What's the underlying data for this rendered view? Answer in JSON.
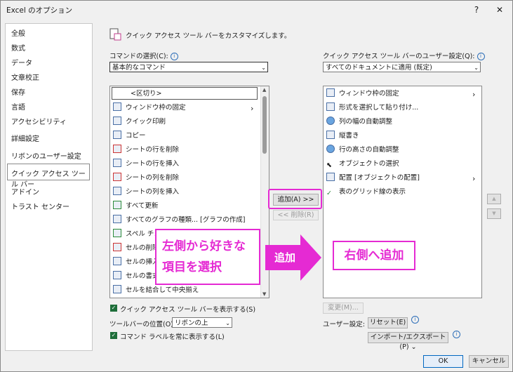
{
  "window": {
    "title": "Excel のオプション",
    "help": "?",
    "close": "✕"
  },
  "sidebar": {
    "items": [
      {
        "label": "全般"
      },
      {
        "label": "数式"
      },
      {
        "label": "データ"
      },
      {
        "label": "文章校正"
      },
      {
        "label": "保存"
      },
      {
        "label": "言語"
      },
      {
        "label": "アクセシビリティ"
      },
      {
        "label": "詳細設定"
      },
      {
        "label": "リボンのユーザー設定"
      },
      {
        "label": "クイック アクセス ツール バー"
      },
      {
        "label": "アドイン"
      },
      {
        "label": "トラスト センター"
      }
    ],
    "selected": "クイック アクセス ツール バー"
  },
  "header": {
    "text": "クイック アクセス ツール バーをカスタマイズします。"
  },
  "left": {
    "choose_label": "コマンドの選択(C):",
    "choose_value": "基本的なコマンド",
    "commands": [
      {
        "label": "<区切り>",
        "icon": "separator"
      },
      {
        "label": "ウィンドウ枠の固定",
        "icon": "freeze-panes-icon",
        "submenu": "›"
      },
      {
        "label": "クイック印刷",
        "icon": "quick-print-icon"
      },
      {
        "label": "コピー",
        "icon": "copy-icon"
      },
      {
        "label": "シートの行を削除",
        "icon": "delete-row-icon"
      },
      {
        "label": "シートの行を挿入",
        "icon": "insert-row-icon"
      },
      {
        "label": "シートの列を削除",
        "icon": "delete-column-icon"
      },
      {
        "label": "シートの列を挿入",
        "icon": "insert-column-icon"
      },
      {
        "label": "すべて更新",
        "icon": "refresh-all-icon"
      },
      {
        "label": "すべてのグラフの種類... [グラフの作成]",
        "icon": "chart-icon"
      },
      {
        "label": "スペル チェ",
        "icon": "spell-check-icon"
      },
      {
        "label": "セルの削除",
        "icon": "delete-cells-icon"
      },
      {
        "label": "セルの挿入",
        "icon": "insert-cells-icon"
      },
      {
        "label": "セルの書式",
        "icon": "format-cells-icon"
      },
      {
        "label": "セルを結合して中央揃え",
        "icon": "merge-center-icon"
      }
    ],
    "show_qat": "クイック アクセス ツール バーを表示する(S)",
    "position_label": "ツールバーの位置(O)",
    "position_value": "リボンの上",
    "always_labels": "コマンド ラベルを常に表示する(L)"
  },
  "middle": {
    "add": "追加(A) >>",
    "remove": "<< 削除(R)"
  },
  "right": {
    "customize_label": "クイック アクセス ツール バーのユーザー設定(Q):",
    "customize_value": "すべてのドキュメントに適用 (既定)",
    "items": [
      {
        "label": "ウィンドウ枠の固定",
        "submenu": "›"
      },
      {
        "label": "形式を選択して貼り付け..."
      },
      {
        "label": "列の幅の自動調整"
      },
      {
        "label": "縦書き"
      },
      {
        "label": "行の高さの自動調整"
      },
      {
        "label": "オブジェクトの選択"
      },
      {
        "label": "配置 [オブジェクトの配置]",
        "submenu": "›"
      },
      {
        "label": "表のグリッド線の表示"
      }
    ],
    "modify": "変更(M)...",
    "user_settings": "ユーザー設定:",
    "reset": "リセット(E)",
    "import_export": "インポート/エクスポート(P)"
  },
  "annotations": {
    "left_line1": "左側から好きな",
    "left_line2": "項目を選択",
    "arrow": "追加",
    "right": "右側へ追加"
  },
  "footer": {
    "ok": "OK",
    "cancel": "キャンセル"
  },
  "colors": {
    "accent": "#e52ad3",
    "check": "#1e6e3a"
  }
}
